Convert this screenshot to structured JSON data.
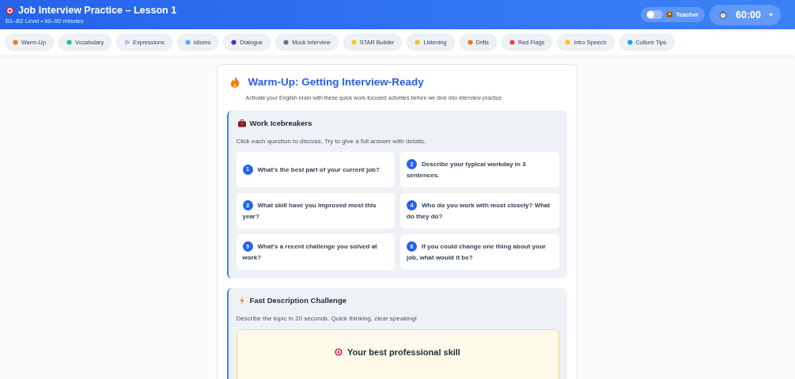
{
  "header": {
    "title": "Job Interview Practice – Lesson 1",
    "subtitle": "B1–B2 Level • 60–90 minutes",
    "teacher_toggle": {
      "label": "Teacher",
      "on": false
    },
    "timer": {
      "value": "60:00"
    }
  },
  "tabs": [
    {
      "label": "Warm-Up"
    },
    {
      "label": "Vocabulary"
    },
    {
      "label": "Expressions"
    },
    {
      "label": "Idioms"
    },
    {
      "label": "Dialogue"
    },
    {
      "label": "Mock Interview"
    },
    {
      "label": "STAR Builder"
    },
    {
      "label": "Listening"
    },
    {
      "label": "Drills"
    },
    {
      "label": "Red Flags"
    },
    {
      "label": "Intro Speech"
    },
    {
      "label": "Culture Tips"
    }
  ],
  "section": {
    "title": "Warm-Up: Getting Interview-Ready",
    "intro": "Activate your English brain with these quick work-focused activities before we dive into interview practice.",
    "activities": [
      {
        "kind": "questions",
        "title": "Work Icebreakers",
        "instructions": "Click each question to discuss. Try to give a full answer with details.",
        "questions": [
          {
            "number": "1",
            "text": "What's the best part of your current job?"
          },
          {
            "number": "2",
            "text": "Describe your typical workday in 3 sentences."
          },
          {
            "number": "3",
            "text": "What skill have you improved most this year?"
          },
          {
            "number": "4",
            "text": "Who do you work with most closely? What do they do?"
          },
          {
            "number": "5",
            "text": "What's a recent challenge you solved at work?"
          },
          {
            "number": "6",
            "text": "If you could change one thing about your job, what would it be?"
          }
        ]
      },
      {
        "kind": "challenge",
        "title": "Fast Description Challenge",
        "instructions": "Describe the topic in 20 seconds. Quick thinking, clear speaking!",
        "topic": "Your best professional skill"
      }
    ]
  }
}
